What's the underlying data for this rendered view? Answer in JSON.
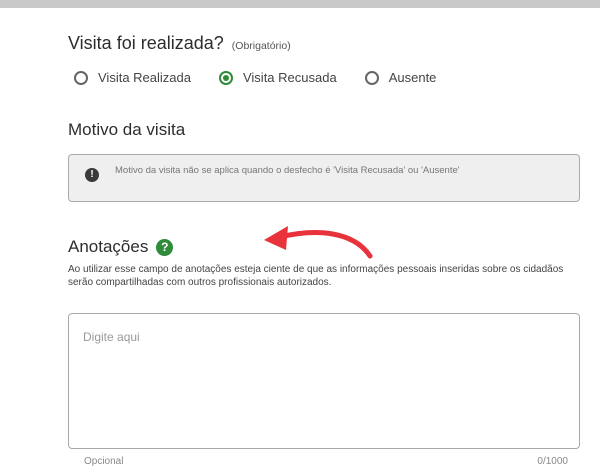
{
  "visit_question": {
    "label": "Visita foi realizada?",
    "required_note": "(Obrigatório)",
    "options": [
      {
        "label": "Visita Realizada",
        "selected": false
      },
      {
        "label": "Visita Recusada",
        "selected": true
      },
      {
        "label": "Ausente",
        "selected": false
      }
    ]
  },
  "motivo": {
    "title": "Motivo da visita",
    "info_text": "Motivo da visita não se aplica quando o desfecho é 'Visita Recusada' ou 'Ausente'",
    "icon": "info-icon"
  },
  "anotacoes": {
    "title": "Anotações",
    "help_icon": "?",
    "disclaimer": "Ao utilizar esse campo de anotações esteja ciente de que as informações pessoais inseridas sobre os cidadãos serão compartilhadas com outros profissionais autorizados.",
    "placeholder": "Digite aqui",
    "value": "",
    "helper_text": "Opcional",
    "counter": "0/1000"
  },
  "colors": {
    "accent_green": "#2e8b3a",
    "annotation_arrow": "#e8333d"
  }
}
